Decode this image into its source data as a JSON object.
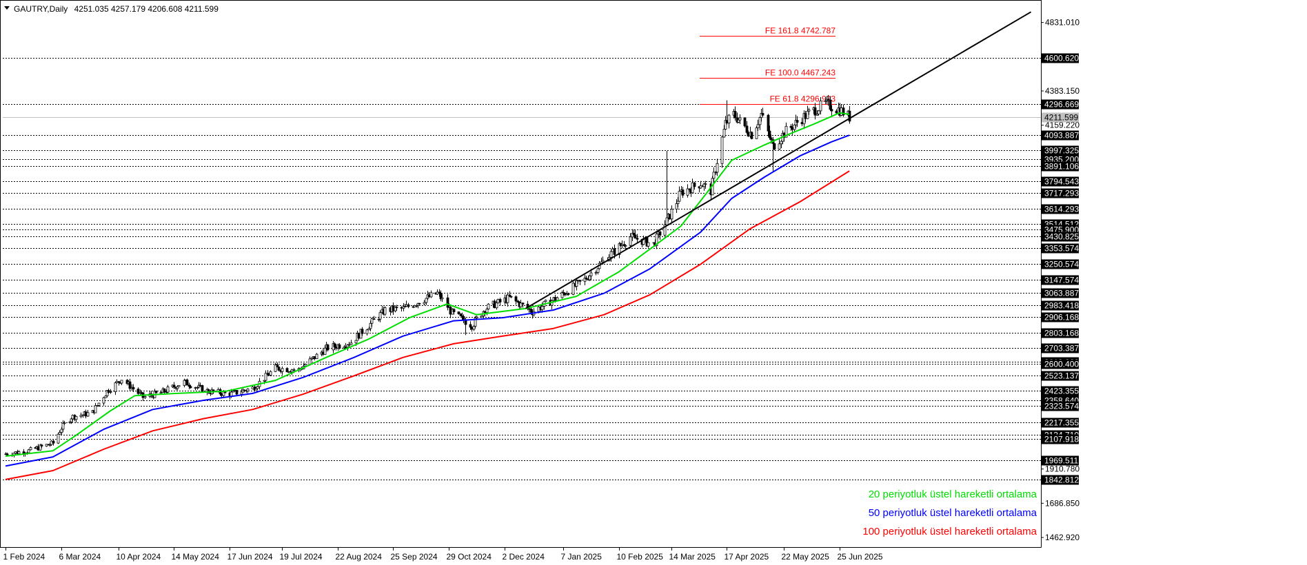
{
  "header": {
    "symbol": "GAUTRY,Daily",
    "ohlc": "4251.035 4257.179 4206.608 4211.599"
  },
  "colors": {
    "ema20": "#00dd00",
    "ema50": "#0000ff",
    "ema100": "#ff0000",
    "trendline": "#000000",
    "fe": "#ff0000",
    "candle": "#000000"
  },
  "legend": [
    {
      "text": "20 periyotluk üstel hareketli ortalama",
      "color": "#00dd00"
    },
    {
      "text": "50 periyotluk üstel hareketli ortalama",
      "color": "#0000ff"
    },
    {
      "text": "100 periyotluk üstel hareketli ortalama",
      "color": "#ff0000"
    }
  ],
  "chart_data": {
    "type": "candlestick",
    "ylim": [
      1400,
      4960
    ],
    "price_ticks": [
      "4831.010",
      "4383.150",
      "4159.220",
      "1910.780",
      "1686.850",
      "1462.920"
    ],
    "level_lines": [
      "4600.620",
      "4296.669",
      "4093.887",
      "3997.325",
      "3935.200",
      "3891.106",
      "3794.543",
      "3717.293",
      "3614.293",
      "3514.512",
      "3475.900",
      "3430.825",
      "3353.574",
      "3250.574",
      "3147.574",
      "3063.887",
      "2983.418",
      "2906.168",
      "2803.168",
      "2703.387",
      "2613.262",
      "2600.400",
      "2523.137",
      "2423.355",
      "2358.640",
      "2323.574",
      "2217.355",
      "2134.710",
      "2107.918",
      "1969.511",
      "1842.812"
    ],
    "current_price": "4211.599",
    "fe_levels": [
      {
        "label": "FE 161.8 4742.787",
        "value": 4742.787
      },
      {
        "label": "FE 100.0 4467.243",
        "value": 4467.243
      },
      {
        "label": "FE 61.8 4296.923",
        "value": 4296.923
      }
    ],
    "x_labels": [
      "1 Feb 2024",
      "6 Mar 2024",
      "10 Apr 2024",
      "14 May 2024",
      "17 Jun 2024",
      "19 Jul 2024",
      "22 Aug 2024",
      "25 Sep 2024",
      "29 Oct 2024",
      "2 Dec 2024",
      "7 Jan 2025",
      "10 Feb 2025",
      "14 Mar 2025",
      "17 Apr 2025",
      "22 May 2025",
      "25 Jun 2025"
    ],
    "price_path": [
      {
        "d": "2024-02-01",
        "p": 2010
      },
      {
        "d": "2024-02-15",
        "p": 2030
      },
      {
        "d": "2024-03-01",
        "p": 2080
      },
      {
        "d": "2024-03-06",
        "p": 2180
      },
      {
        "d": "2024-03-12",
        "p": 2250
      },
      {
        "d": "2024-03-25",
        "p": 2280
      },
      {
        "d": "2024-04-03",
        "p": 2420
      },
      {
        "d": "2024-04-12",
        "p": 2500
      },
      {
        "d": "2024-04-25",
        "p": 2380
      },
      {
        "d": "2024-05-06",
        "p": 2410
      },
      {
        "d": "2024-05-20",
        "p": 2480
      },
      {
        "d": "2024-06-03",
        "p": 2420
      },
      {
        "d": "2024-06-17",
        "p": 2400
      },
      {
        "d": "2024-07-01",
        "p": 2440
      },
      {
        "d": "2024-07-15",
        "p": 2570
      },
      {
        "d": "2024-07-29",
        "p": 2560
      },
      {
        "d": "2024-08-15",
        "p": 2700
      },
      {
        "d": "2024-08-30",
        "p": 2740
      },
      {
        "d": "2024-09-20",
        "p": 2950
      },
      {
        "d": "2024-10-01",
        "p": 2960
      },
      {
        "d": "2024-10-22",
        "p": 3060
      },
      {
        "d": "2024-10-31",
        "p": 2930
      },
      {
        "d": "2024-11-12",
        "p": 2850
      },
      {
        "d": "2024-11-20",
        "p": 2960
      },
      {
        "d": "2024-12-05",
        "p": 3030
      },
      {
        "d": "2024-12-19",
        "p": 2940
      },
      {
        "d": "2025-01-06",
        "p": 3050
      },
      {
        "d": "2025-01-20",
        "p": 3150
      },
      {
        "d": "2025-02-03",
        "p": 3300
      },
      {
        "d": "2025-02-17",
        "p": 3430
      },
      {
        "d": "2025-03-03",
        "p": 3380
      },
      {
        "d": "2025-03-12",
        "p": 3550
      },
      {
        "d": "2025-03-20",
        "p": 3720
      },
      {
        "d": "2025-04-01",
        "p": 3780
      },
      {
        "d": "2025-04-07",
        "p": 3730
      },
      {
        "d": "2025-04-16",
        "p": 4170
      },
      {
        "d": "2025-04-21",
        "p": 4230
      },
      {
        "d": "2025-05-02",
        "p": 4100
      },
      {
        "d": "2025-05-08",
        "p": 4230
      },
      {
        "d": "2025-05-15",
        "p": 4020
      },
      {
        "d": "2025-05-23",
        "p": 4120
      },
      {
        "d": "2025-06-05",
        "p": 4230
      },
      {
        "d": "2025-06-16",
        "p": 4300
      },
      {
        "d": "2025-06-25",
        "p": 4260
      },
      {
        "d": "2025-07-01",
        "p": 4212
      }
    ],
    "ema20": [
      {
        "d": "2024-02-01",
        "p": 1995
      },
      {
        "d": "2024-03-01",
        "p": 2030
      },
      {
        "d": "2024-03-15",
        "p": 2130
      },
      {
        "d": "2024-04-05",
        "p": 2290
      },
      {
        "d": "2024-04-20",
        "p": 2390
      },
      {
        "d": "2024-05-15",
        "p": 2405
      },
      {
        "d": "2024-06-15",
        "p": 2420
      },
      {
        "d": "2024-07-15",
        "p": 2490
      },
      {
        "d": "2024-08-15",
        "p": 2640
      },
      {
        "d": "2024-09-10",
        "p": 2760
      },
      {
        "d": "2024-10-05",
        "p": 2900
      },
      {
        "d": "2024-10-28",
        "p": 2990
      },
      {
        "d": "2024-11-15",
        "p": 2920
      },
      {
        "d": "2024-12-15",
        "p": 2960
      },
      {
        "d": "2025-01-15",
        "p": 3040
      },
      {
        "d": "2025-02-10",
        "p": 3200
      },
      {
        "d": "2025-03-05",
        "p": 3380
      },
      {
        "d": "2025-03-20",
        "p": 3500
      },
      {
        "d": "2025-04-05",
        "p": 3720
      },
      {
        "d": "2025-04-20",
        "p": 3930
      },
      {
        "d": "2025-05-10",
        "p": 4030
      },
      {
        "d": "2025-05-25",
        "p": 4100
      },
      {
        "d": "2025-06-10",
        "p": 4170
      },
      {
        "d": "2025-06-25",
        "p": 4240
      },
      {
        "d": "2025-07-01",
        "p": 4230
      }
    ],
    "ema50": [
      {
        "d": "2024-02-01",
        "p": 1930
      },
      {
        "d": "2024-03-01",
        "p": 1990
      },
      {
        "d": "2024-04-01",
        "p": 2170
      },
      {
        "d": "2024-05-01",
        "p": 2300
      },
      {
        "d": "2024-06-01",
        "p": 2360
      },
      {
        "d": "2024-07-01",
        "p": 2405
      },
      {
        "d": "2024-08-01",
        "p": 2510
      },
      {
        "d": "2024-09-01",
        "p": 2640
      },
      {
        "d": "2024-10-01",
        "p": 2780
      },
      {
        "d": "2024-11-01",
        "p": 2880
      },
      {
        "d": "2024-12-01",
        "p": 2900
      },
      {
        "d": "2025-01-01",
        "p": 2950
      },
      {
        "d": "2025-02-01",
        "p": 3060
      },
      {
        "d": "2025-03-01",
        "p": 3220
      },
      {
        "d": "2025-04-01",
        "p": 3460
      },
      {
        "d": "2025-04-20",
        "p": 3680
      },
      {
        "d": "2025-05-10",
        "p": 3820
      },
      {
        "d": "2025-06-01",
        "p": 3960
      },
      {
        "d": "2025-06-20",
        "p": 4050
      },
      {
        "d": "2025-07-01",
        "p": 4094
      }
    ],
    "ema100": [
      {
        "d": "2024-02-01",
        "p": 1842
      },
      {
        "d": "2024-03-01",
        "p": 1900
      },
      {
        "d": "2024-04-01",
        "p": 2040
      },
      {
        "d": "2024-05-01",
        "p": 2160
      },
      {
        "d": "2024-06-01",
        "p": 2240
      },
      {
        "d": "2024-07-01",
        "p": 2300
      },
      {
        "d": "2024-08-01",
        "p": 2400
      },
      {
        "d": "2024-09-01",
        "p": 2520
      },
      {
        "d": "2024-10-01",
        "p": 2640
      },
      {
        "d": "2024-11-01",
        "p": 2730
      },
      {
        "d": "2024-12-01",
        "p": 2780
      },
      {
        "d": "2025-01-01",
        "p": 2830
      },
      {
        "d": "2025-02-01",
        "p": 2920
      },
      {
        "d": "2025-03-01",
        "p": 3050
      },
      {
        "d": "2025-04-01",
        "p": 3250
      },
      {
        "d": "2025-05-01",
        "p": 3480
      },
      {
        "d": "2025-06-01",
        "p": 3660
      },
      {
        "d": "2025-07-01",
        "p": 3860
      }
    ],
    "trendline": [
      {
        "d": "2024-12-15",
        "p": 2960
      },
      {
        "d": "2025-10-20",
        "p": 4900
      }
    ]
  }
}
